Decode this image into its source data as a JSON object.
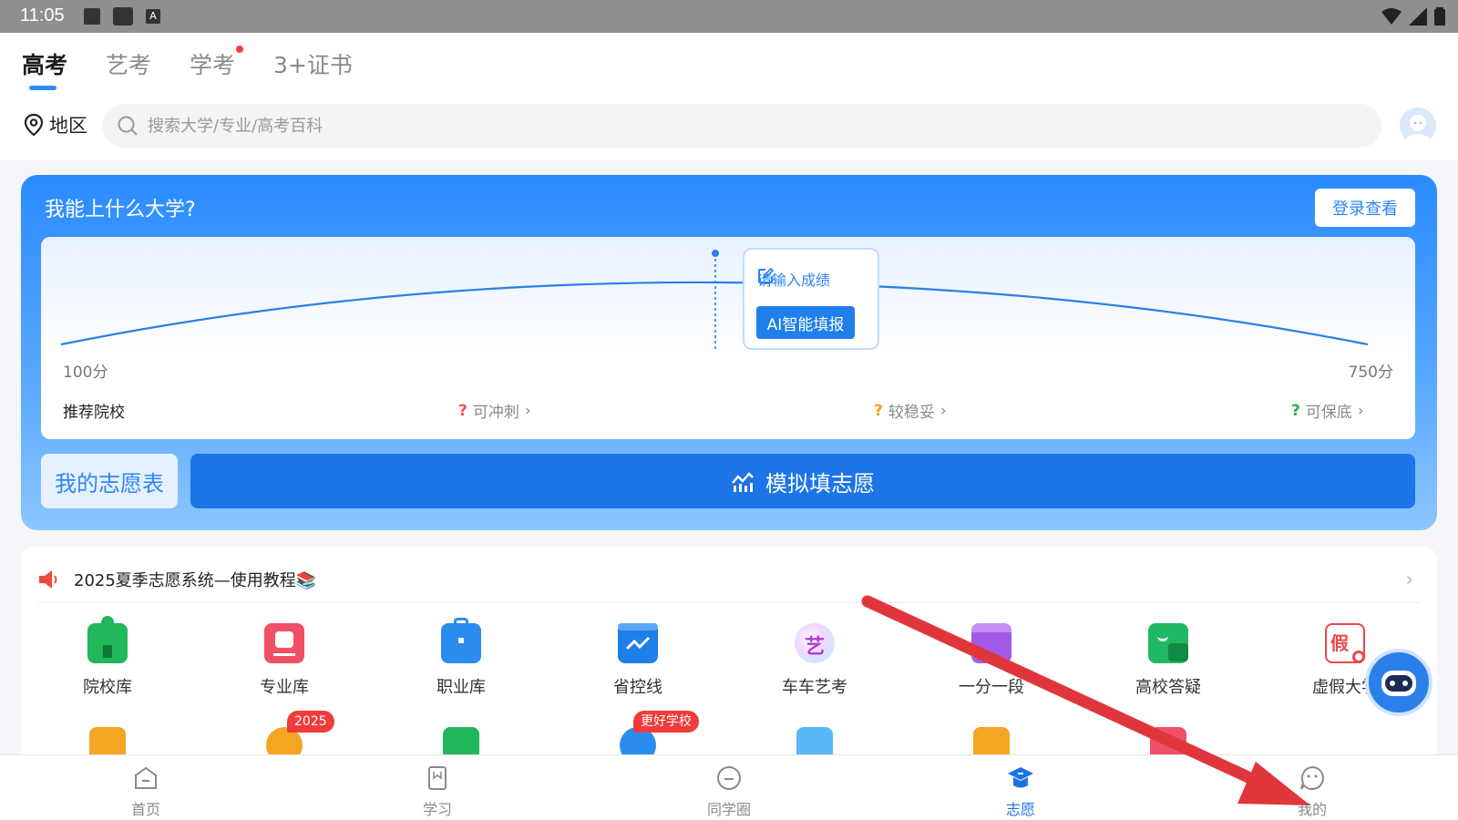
{
  "status_bar": {
    "time": "11:05",
    "icons": [
      "image-icon",
      "square-icon",
      "a-key-icon",
      "wifi-icon",
      "signal-icon",
      "battery-icon"
    ]
  },
  "tabs": [
    {
      "label": "高考",
      "active": true
    },
    {
      "label": "艺考",
      "active": false
    },
    {
      "label": "学考",
      "active": false,
      "dot": true
    },
    {
      "label": "3+证书",
      "active": false
    }
  ],
  "region": {
    "label": "地区"
  },
  "search": {
    "placeholder": "搜索大学/专业/高考百科"
  },
  "score_card": {
    "title": "我能上什么大学?",
    "login_label": "登录查看",
    "enter_score": "请输入成绩",
    "ai_button": "AI智能填报",
    "score_min": "100分",
    "score_max": "750分",
    "recommend_label": "推荐院校",
    "categories": [
      {
        "q": "?",
        "label": "可冲刺",
        "color": "#ff4d4f"
      },
      {
        "q": "?",
        "label": "较稳妥",
        "color": "#fa9a1e"
      },
      {
        "q": "?",
        "label": "可保底",
        "color": "#22b35b"
      }
    ],
    "my_table_label": "我的志愿表",
    "simulate_label": "模拟填志愿"
  },
  "notice": {
    "text": "2025夏季志愿系统—使用教程📚"
  },
  "tools": [
    {
      "label": "院校库",
      "icon": "school-icon",
      "color": "#22b75a"
    },
    {
      "label": "专业库",
      "icon": "book-icon",
      "color": "#f04f67"
    },
    {
      "label": "职业库",
      "icon": "briefcase-icon",
      "color": "#2b8cf0"
    },
    {
      "label": "省控线",
      "icon": "chart-line-icon",
      "color": "#1f7fe8"
    },
    {
      "label": "车车艺考",
      "icon": "art-icon",
      "color": "#c04de0"
    },
    {
      "label": "一分一段",
      "icon": "segment-icon",
      "color": "#a25ae6"
    },
    {
      "label": "高校答疑",
      "icon": "chat-icon",
      "color": "#21b865"
    },
    {
      "label": "虚假大学",
      "icon": "fake-icon",
      "color": "#e84a4a"
    }
  ],
  "tools_row2": [
    {
      "icon": "check-clipboard-icon",
      "color": "#f5a524"
    },
    {
      "icon": "person-icon",
      "color": "#f5a524",
      "badge": "2025"
    },
    {
      "icon": "bar-chart-icon",
      "color": "#22b75a"
    },
    {
      "icon": "leak-icon",
      "color": "#2b8cf0",
      "badge": "更好学校"
    },
    {
      "icon": "enroll-icon",
      "color": "#59b8f5"
    },
    {
      "icon": "play-icon",
      "color": "#f5a524"
    },
    {
      "icon": "new-icon",
      "color": "#f04f67"
    }
  ],
  "bottom_nav": [
    {
      "label": "首页",
      "icon": "home-icon",
      "active": false
    },
    {
      "label": "学习",
      "icon": "study-icon",
      "active": false
    },
    {
      "label": "同学圈",
      "icon": "circle-icon",
      "active": false
    },
    {
      "label": "志愿",
      "icon": "graduation-cap-icon",
      "active": true
    },
    {
      "label": "我的",
      "icon": "profile-icon",
      "active": false
    }
  ],
  "colors": {
    "primary": "#1d74e6",
    "accent": "#2f8cff",
    "annotation_arrow": "#e0363b"
  }
}
